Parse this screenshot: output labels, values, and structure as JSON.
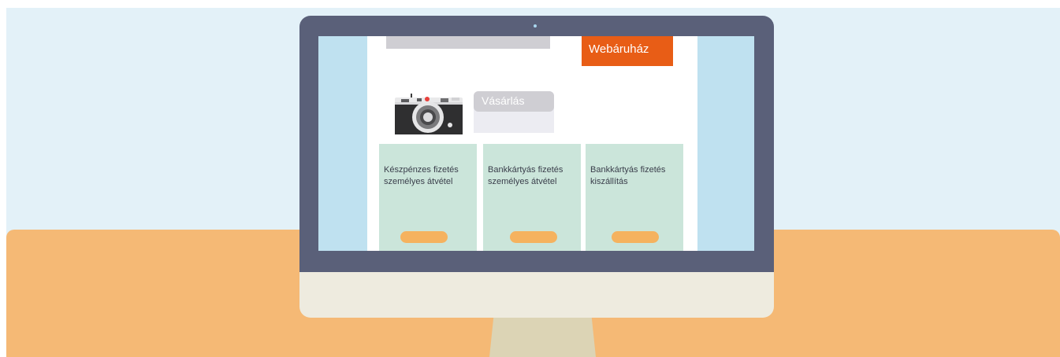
{
  "screen": {
    "shop_label": "Webáruház",
    "purchase_label": "Vásárlás",
    "options": [
      {
        "label": "Készpénzes fizetés\nszemélyes átvétel"
      },
      {
        "label": "Bankkártyás fizetés\nszemélyes átvétel"
      },
      {
        "label": "Bankkártyás fizetés\nkiszállítás"
      }
    ]
  },
  "icons": {
    "camera": "camera-icon"
  },
  "colors": {
    "background_sky": "#e3f1f8",
    "desk": "#f5b975",
    "bezel": "#5a6079",
    "chin": "#eeebdf",
    "stand": "#dcd4b5",
    "screen_side": "#bfe1f0",
    "accent_orange": "#e85d16",
    "card_green": "#cbe5da",
    "card_button": "#f5b25f",
    "gray_bar": "#cfced3"
  }
}
